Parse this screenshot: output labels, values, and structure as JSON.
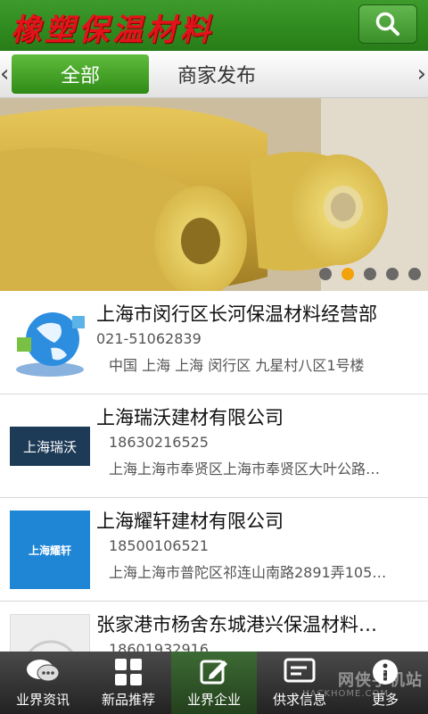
{
  "header": {
    "title": "橡塑保温材料",
    "search_icon": "search-icon"
  },
  "tabs": {
    "items": [
      {
        "label": "全部",
        "active": true
      },
      {
        "label": "商家发布",
        "active": false
      }
    ],
    "left_arrow": "‹",
    "right_arrow": "›"
  },
  "banner": {
    "dot_count": 5,
    "active_dot": 1
  },
  "list": [
    {
      "name": "上海市闵行区长河保温材料经营部",
      "phone": "021-51062839",
      "address": "中国 上海 上海 闵行区 九星村八区1号楼",
      "thumb_text": ""
    },
    {
      "name": "上海瑞沃建材有限公司",
      "phone": "18630216525",
      "address": "上海上海市奉贤区上海市奉贤区大叶公路…",
      "thumb_text": "上海瑞沃"
    },
    {
      "name": "上海耀轩建材有限公司",
      "phone": "18500106521",
      "address": "上海上海市普陀区祁连山南路2891弄105…",
      "thumb_text": "上海耀轩"
    },
    {
      "name": "张家港市杨舍东城港兴保温材料…",
      "phone": "18601932916",
      "address": "",
      "thumb_text": ""
    }
  ],
  "bottom_nav": [
    {
      "label": "业界资讯",
      "icon": "chat-bubbles-icon",
      "active": false
    },
    {
      "label": "新品推荐",
      "icon": "grid-icon",
      "active": false
    },
    {
      "label": "业界企业",
      "icon": "edit-icon",
      "active": true
    },
    {
      "label": "供求信息",
      "icon": "message-icon",
      "active": false
    },
    {
      "label": "更多",
      "icon": "more-icon",
      "active": false
    }
  ],
  "watermark": {
    "text": "网侠手机站",
    "sub": "HACKHOME.COM"
  }
}
